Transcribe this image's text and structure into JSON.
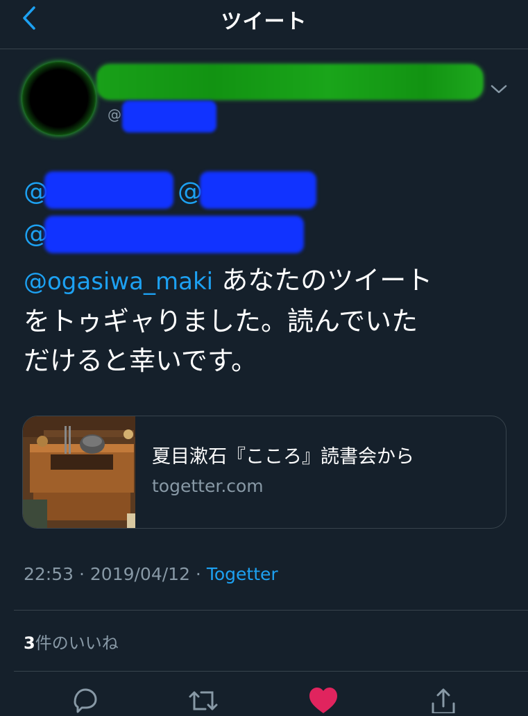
{
  "header": {
    "title": "ツイート",
    "back_icon": "chevron-left-icon"
  },
  "author": {
    "handle_prefix": "@"
  },
  "mentions": {
    "prefix": "@"
  },
  "tweet": {
    "mention": "@ogasiwa_maki",
    "text_line1": " あなたのツイート",
    "text_line2": "をトゥギャりました。読んでいた",
    "text_line3": "だけると幸いです。"
  },
  "card": {
    "title": "夏目漱石『こころ』読書会から",
    "domain": "togetter.com"
  },
  "meta": {
    "time": "22:53",
    "separator1": " · ",
    "date": "2019/04/12",
    "separator2": " · ",
    "source": "Togetter"
  },
  "likes": {
    "count": "3",
    "label": "件のいいね"
  },
  "actions": [
    {
      "icon": "reply-icon"
    },
    {
      "icon": "retweet-icon"
    },
    {
      "icon": "heart-icon",
      "active": true
    },
    {
      "icon": "share-icon"
    }
  ],
  "colors": {
    "background": "#15202b",
    "accent": "#1da1f2",
    "secondary_text": "#8899a6",
    "border": "#38444d",
    "like_active": "#e0245e"
  }
}
